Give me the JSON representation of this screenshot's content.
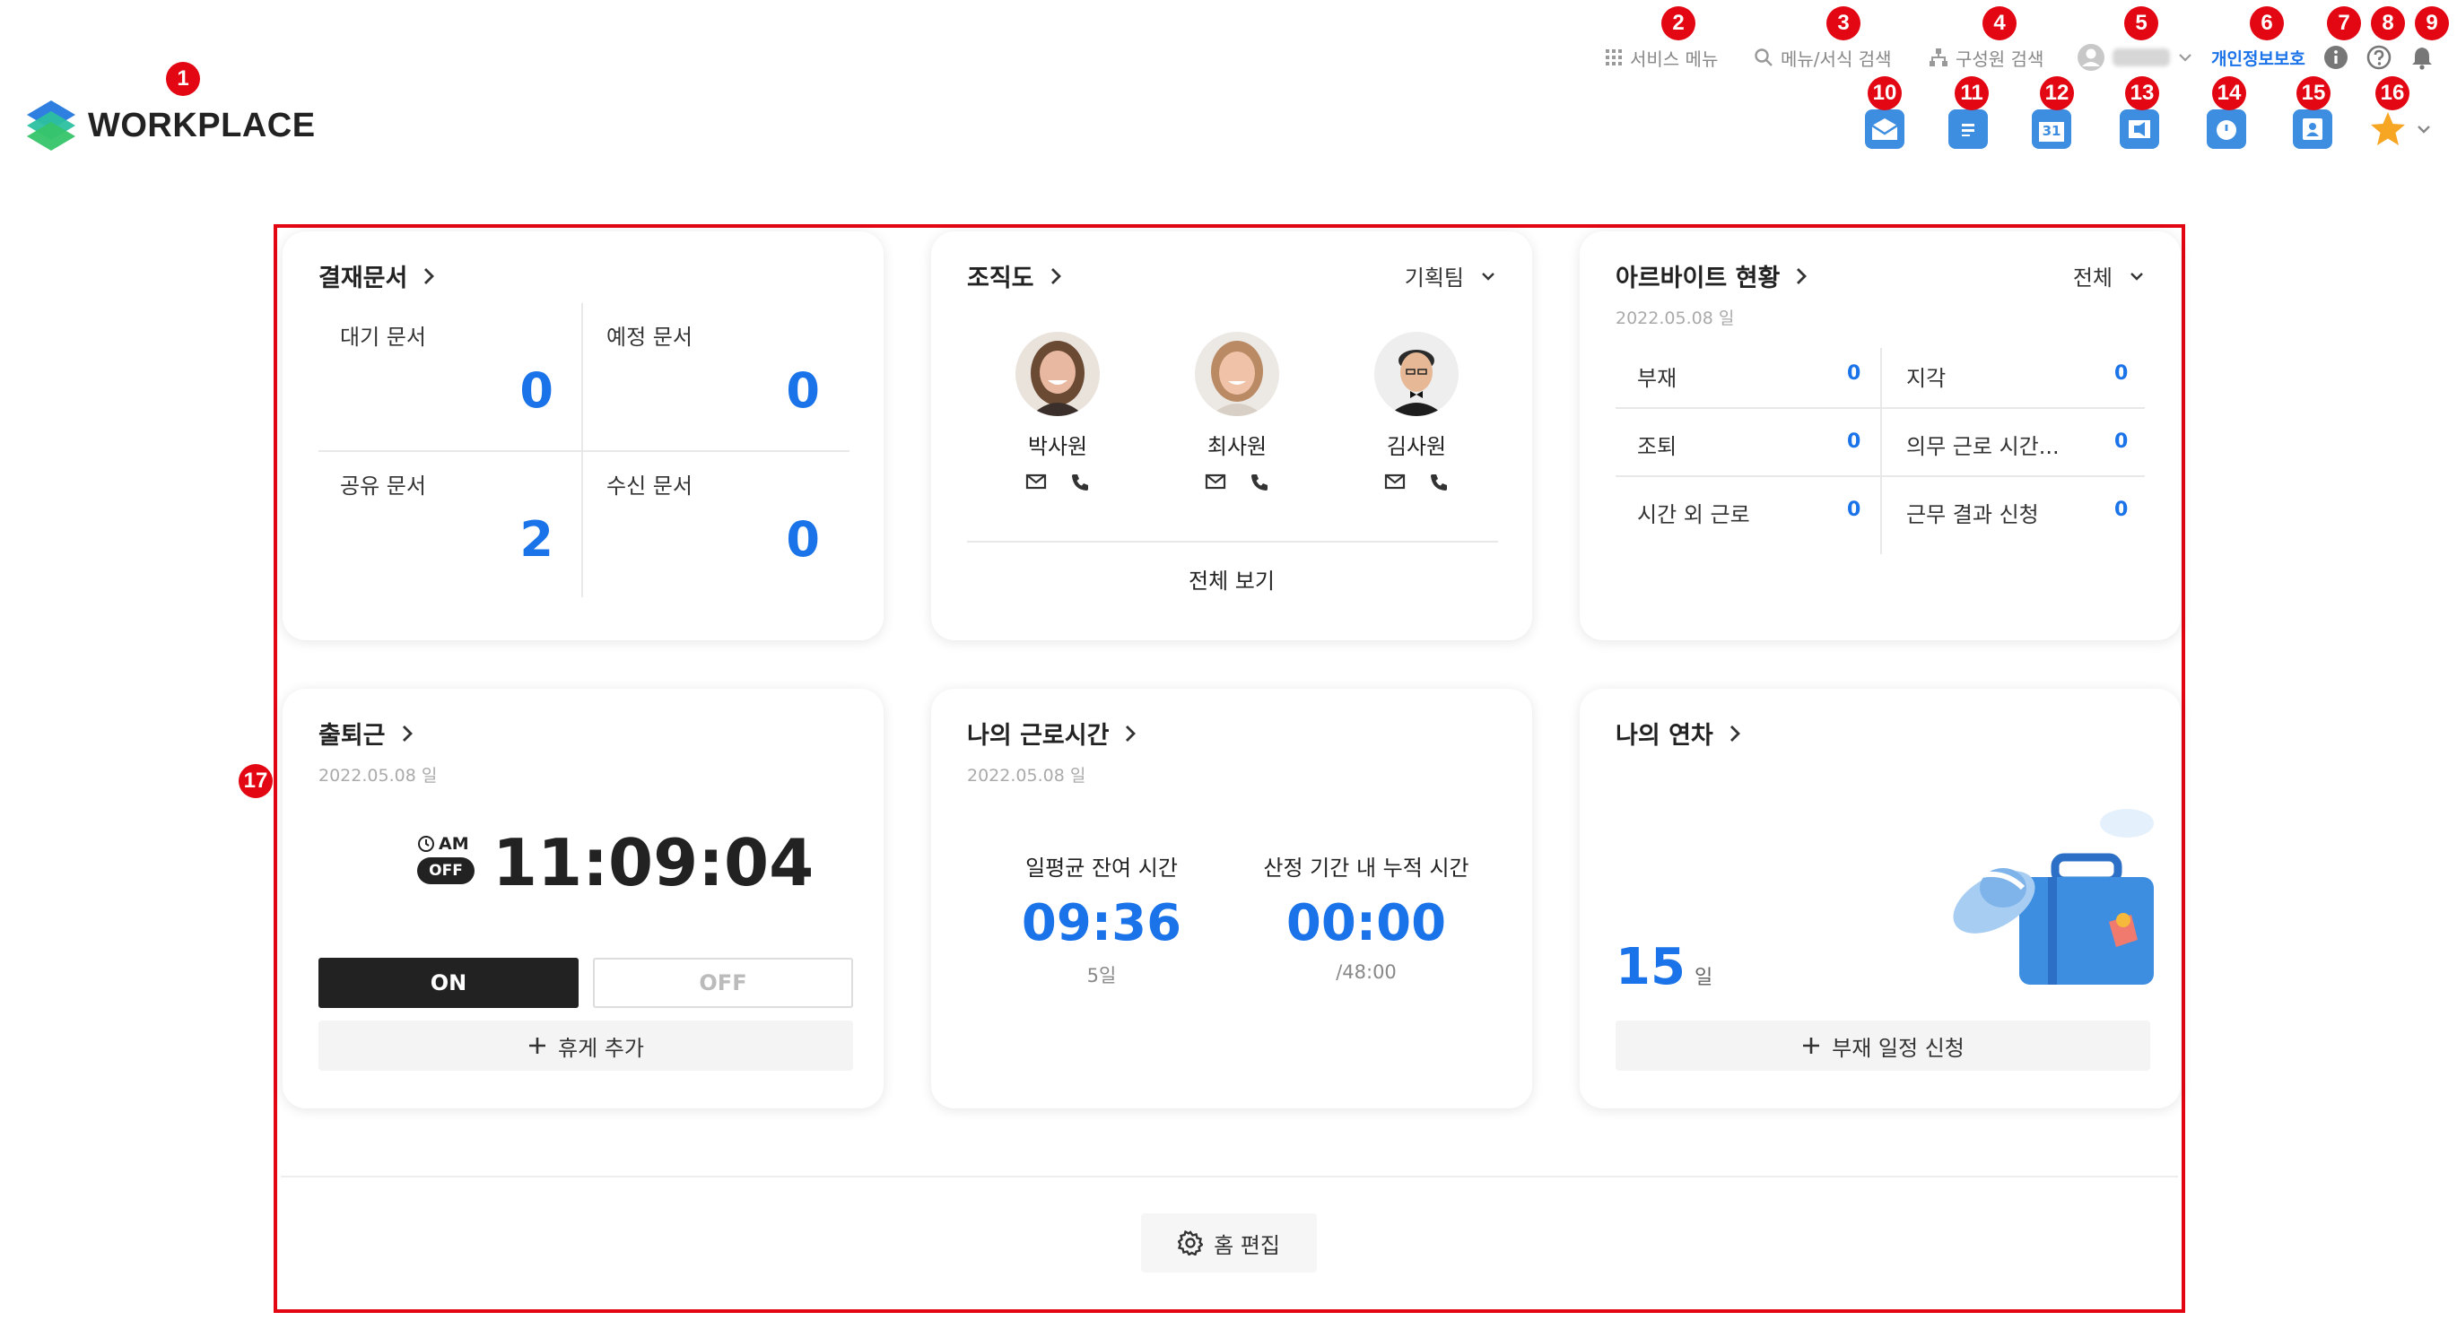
{
  "header": {
    "logo_text": "WORKPLACE",
    "nav": {
      "service_menu": "서비스 메뉴",
      "menu_search": "메뉴/서식 검색",
      "member_search": "구성원 검색",
      "privacy": "개인정보보호"
    }
  },
  "app_icons": [
    "mail-icon",
    "board-icon",
    "calendar-icon",
    "notice-icon",
    "clock-icon",
    "contacts-icon",
    "favorites-star-icon"
  ],
  "calendar_day": "31",
  "markers": [
    "1",
    "2",
    "3",
    "4",
    "5",
    "6",
    "7",
    "8",
    "9",
    "10",
    "11",
    "12",
    "13",
    "14",
    "15",
    "16",
    "17"
  ],
  "approval": {
    "title": "결재문서",
    "cells": [
      {
        "label": "대기 문서",
        "value": "0"
      },
      {
        "label": "예정 문서",
        "value": "0"
      },
      {
        "label": "공유 문서",
        "value": "2"
      },
      {
        "label": "수신 문서",
        "value": "0"
      }
    ]
  },
  "org": {
    "title": "조직도",
    "team": "기획팀",
    "people": [
      {
        "name": "박사원"
      },
      {
        "name": "최사원"
      },
      {
        "name": "김사원"
      }
    ],
    "view_all": "전체 보기"
  },
  "alba": {
    "title": "아르바이트 현황",
    "date": "2022.05.08 일",
    "filter": "전체",
    "rows": [
      {
        "label": "부재",
        "value": "0"
      },
      {
        "label": "지각",
        "value": "0"
      },
      {
        "label": "조퇴",
        "value": "0"
      },
      {
        "label": "의무 근로 시간...",
        "value": "0"
      },
      {
        "label": "시간 외 근로",
        "value": "0"
      },
      {
        "label": "근무 결과 신청",
        "value": "0"
      }
    ]
  },
  "attendance": {
    "title": "출퇴근",
    "date": "2022.05.08 일",
    "ampm": "AM",
    "status": "OFF",
    "time": "11:09:04",
    "on_label": "ON",
    "off_label": "OFF",
    "break_label": "휴게 추가"
  },
  "worktime": {
    "title": "나의 근로시간",
    "date": "2022.05.08 일",
    "left_label": "일평균 잔여 시간",
    "left_value": "09:36",
    "left_sub": "5일",
    "right_label": "산정 기간 내 누적 시간",
    "right_value": "00:00",
    "right_sub": "/48:00"
  },
  "leave": {
    "title": "나의 연차",
    "days": "15",
    "unit": "일",
    "apply_label": "부재 일정 신청"
  },
  "edit_home": "홈 편집"
}
